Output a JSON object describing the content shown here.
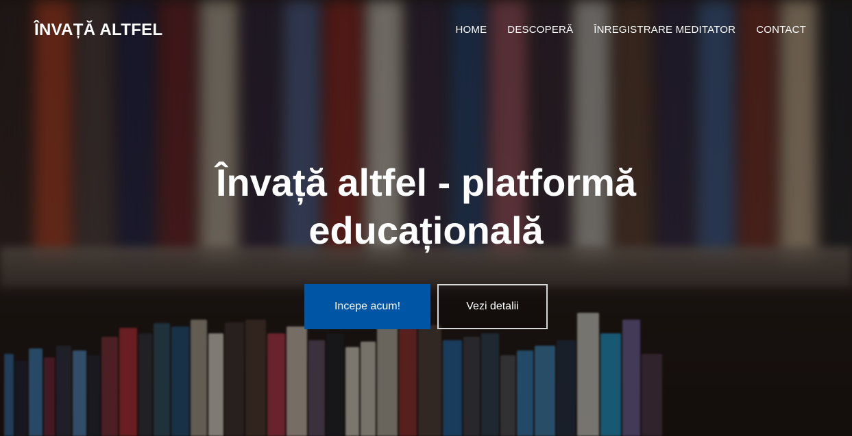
{
  "brand": {
    "title": "ÎNVAȚĂ ALTFEL"
  },
  "nav": {
    "items": [
      {
        "label": "HOME"
      },
      {
        "label": "DESCOPERĂ"
      },
      {
        "label": "ÎNREGISTRARE MEDITATOR"
      },
      {
        "label": "CONTACT"
      }
    ]
  },
  "hero": {
    "headline": "Învață altfel - platformă educațională",
    "primary_button": "Incepe acum!",
    "secondary_button": "Vezi detalii"
  },
  "colors": {
    "primary_button_bg": "#0055a4",
    "text": "#ffffff",
    "outline_border": "#d8d8d8"
  }
}
